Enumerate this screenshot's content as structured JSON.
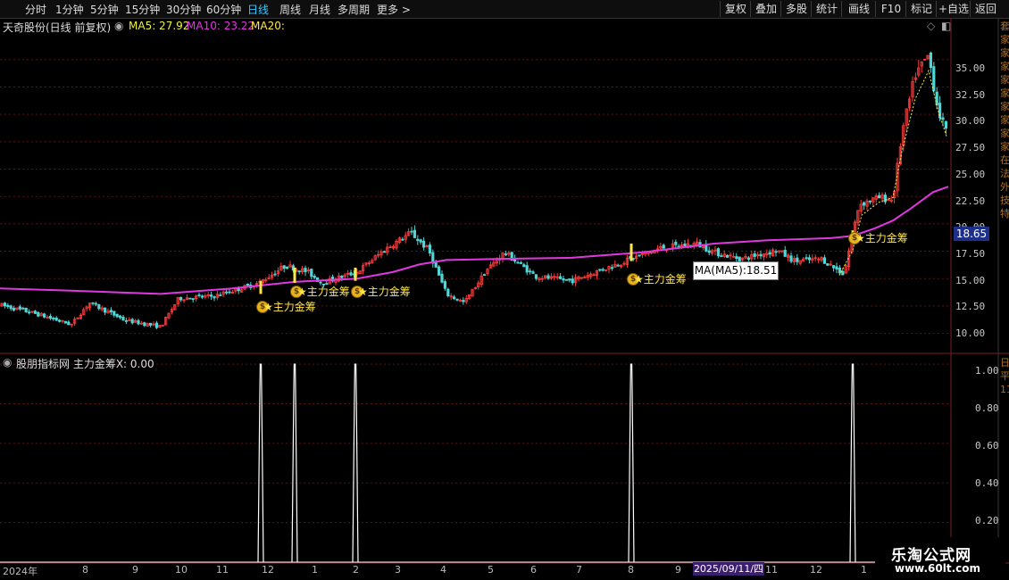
{
  "toolbar": {
    "periods": [
      "分时",
      "1分钟",
      "5分钟",
      "15分钟",
      "30分钟",
      "60分钟",
      "日线",
      "周线",
      "月线",
      "多周期",
      "更多 >"
    ],
    "active_period": "日线",
    "buttons": [
      "复权",
      "叠加",
      "多股",
      "统计",
      "画线",
      "F10",
      "标记",
      "+自选",
      "返回"
    ]
  },
  "header": {
    "stock": "天奇股份(日线 前复权)",
    "ma5": "MA5: 27.92",
    "ma10": "MA10: 23.22",
    "ma20": "MA20:"
  },
  "price_axis": [
    "35.00",
    "32.50",
    "30.00",
    "27.50",
    "25.00",
    "22.50",
    "20.00",
    "17.50",
    "15.00",
    "12.50",
    "10.00"
  ],
  "price_tag": "18.65",
  "tooltip": "MA(MA5):18.51",
  "signal_label": "★主力金筹",
  "coin_glyph": "$",
  "indicator": {
    "title": "股朋指标网 主力金筹X: 0.00",
    "axis": [
      "1.00",
      "0.80",
      "0.60",
      "0.40",
      "0.20"
    ]
  },
  "x_axis": [
    "2024年",
    "8",
    "9",
    "10",
    "11",
    "12",
    "1",
    "2",
    "3",
    "4",
    "5",
    "6",
    "7",
    "8",
    "9",
    "11",
    "12",
    "1"
  ],
  "date_box": "2025/09/11/四",
  "watermark": {
    "line1": "乐淘公式网",
    "line2": "www.60lt.com"
  },
  "right_strip_chars": "套家家家家家家家家家在法外技特",
  "right_strip_lower": "日平1111",
  "colors": {
    "up": "#ff3c3c",
    "down": "#4fd6d6",
    "ma_line": "#e038e0",
    "signal": "#ffe64a",
    "active": "#38c6ff"
  },
  "chart_data": {
    "type": "candlestick",
    "signals_x_dates": [
      "2024-12",
      "2025-01",
      "2025-02",
      "2025-08",
      "2026-01"
    ],
    "indicator_values": [
      0,
      1.0,
      0,
      1.0,
      0,
      1.0,
      0,
      1.0,
      0,
      1.0,
      0
    ],
    "ylim": [
      8.5,
      38
    ],
    "indicator_ylim": [
      0,
      1.05
    ]
  }
}
